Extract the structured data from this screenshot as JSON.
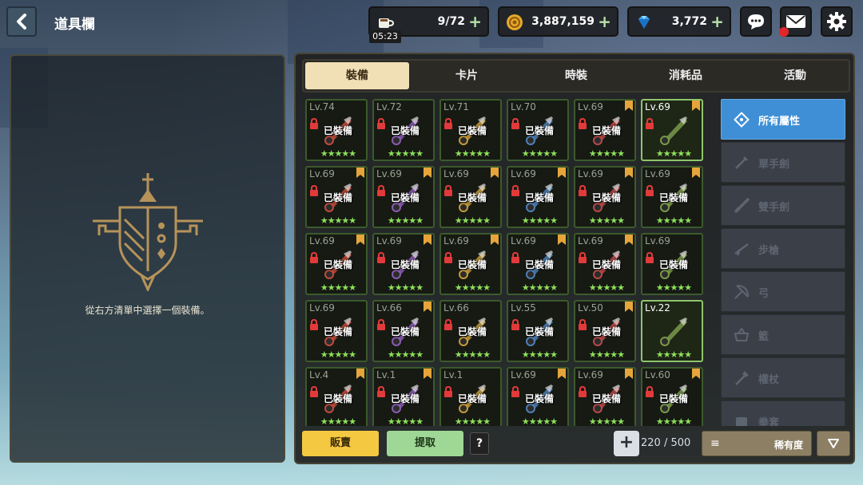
{
  "header": {
    "title": "道具欄",
    "stamina": "9/72",
    "stamina_timer": "05:23",
    "gold": "3,887,159",
    "gems": "3,772"
  },
  "left_panel": {
    "hint": "從右方清單中選擇一個裝備。"
  },
  "tabs": [
    "裝備",
    "卡片",
    "時裝",
    "消耗品",
    "活動"
  ],
  "active_tab": "裝備",
  "equipped_label": "已裝備",
  "star_text": "★★★★★",
  "items": [
    {
      "lv": "Lv.74",
      "equipped": true,
      "locked": true,
      "flag": false
    },
    {
      "lv": "Lv.72",
      "equipped": true,
      "locked": true,
      "flag": false
    },
    {
      "lv": "Lv.71",
      "equipped": true,
      "locked": true,
      "flag": false
    },
    {
      "lv": "Lv.70",
      "equipped": true,
      "locked": true,
      "flag": false
    },
    {
      "lv": "Lv.69",
      "equipped": true,
      "locked": true,
      "flag": true
    },
    {
      "lv": "Lv.69",
      "equipped": false,
      "locked": true,
      "flag": true,
      "highlight": true
    },
    {
      "lv": "Lv.69",
      "equipped": true,
      "locked": true,
      "flag": true
    },
    {
      "lv": "Lv.69",
      "equipped": true,
      "locked": true,
      "flag": true
    },
    {
      "lv": "Lv.69",
      "equipped": true,
      "locked": true,
      "flag": true
    },
    {
      "lv": "Lv.69",
      "equipped": true,
      "locked": true,
      "flag": true
    },
    {
      "lv": "Lv.69",
      "equipped": true,
      "locked": true,
      "flag": true
    },
    {
      "lv": "Lv.69",
      "equipped": true,
      "locked": true,
      "flag": true
    },
    {
      "lv": "Lv.69",
      "equipped": true,
      "locked": true,
      "flag": true
    },
    {
      "lv": "Lv.69",
      "equipped": true,
      "locked": true,
      "flag": true
    },
    {
      "lv": "Lv.69",
      "equipped": true,
      "locked": true,
      "flag": true
    },
    {
      "lv": "Lv.69",
      "equipped": true,
      "locked": true,
      "flag": true
    },
    {
      "lv": "Lv.69",
      "equipped": true,
      "locked": true,
      "flag": true
    },
    {
      "lv": "Lv.69",
      "equipped": true,
      "locked": true,
      "flag": false
    },
    {
      "lv": "Lv.69",
      "equipped": true,
      "locked": true,
      "flag": false
    },
    {
      "lv": "Lv.66",
      "equipped": true,
      "locked": true,
      "flag": true
    },
    {
      "lv": "Lv.66",
      "equipped": true,
      "locked": true,
      "flag": false
    },
    {
      "lv": "Lv.55",
      "equipped": true,
      "locked": true,
      "flag": false
    },
    {
      "lv": "Lv.50",
      "equipped": true,
      "locked": true,
      "flag": true
    },
    {
      "lv": "Lv.22",
      "equipped": false,
      "locked": false,
      "flag": false,
      "highlight": true
    },
    {
      "lv": "Lv.4",
      "equipped": true,
      "locked": true,
      "flag": true
    },
    {
      "lv": "Lv.1",
      "equipped": true,
      "locked": true,
      "flag": true
    },
    {
      "lv": "Lv.1",
      "equipped": true,
      "locked": true,
      "flag": false
    },
    {
      "lv": "Lv.69",
      "equipped": true,
      "locked": true,
      "flag": true
    },
    {
      "lv": "Lv.69",
      "equipped": true,
      "locked": true,
      "flag": true
    },
    {
      "lv": "Lv.60",
      "equipped": true,
      "locked": true,
      "flag": true
    }
  ],
  "filters": [
    {
      "label": "所有屬性",
      "icon": "all-attributes-icon",
      "active": true
    },
    {
      "label": "單手劍",
      "icon": "one-hand-sword-icon",
      "active": false
    },
    {
      "label": "雙手劍",
      "icon": "two-hand-sword-icon",
      "active": false
    },
    {
      "label": "步槍",
      "icon": "rifle-icon",
      "active": false
    },
    {
      "label": "弓",
      "icon": "bow-icon",
      "active": false
    },
    {
      "label": "籃",
      "icon": "basket-icon",
      "active": false
    },
    {
      "label": "權杖",
      "icon": "staff-icon",
      "active": false
    },
    {
      "label": "拳套",
      "icon": "gauntlet-icon",
      "active": false
    }
  ],
  "bottom": {
    "sell": "販賣",
    "extract": "提取",
    "help": "?",
    "expand": "+",
    "capacity": "220 / 500",
    "sort_label": "稀有度",
    "sort_icon": "≡"
  },
  "colors": {
    "accent_blue": "#3f8fd6",
    "sell_yellow": "#f5c842",
    "extract_green": "#9fd896",
    "star_green": "#8fe05a",
    "tab_active": "#f1dfb6"
  }
}
